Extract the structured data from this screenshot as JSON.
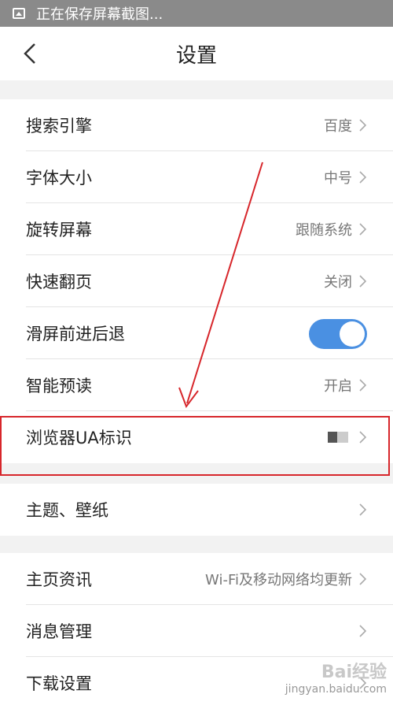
{
  "status_bar": {
    "message": "正在保存屏幕截图..."
  },
  "header": {
    "title": "设置"
  },
  "groups": [
    {
      "rows": [
        {
          "label": "搜索引擎",
          "value": "百度"
        },
        {
          "label": "字体大小",
          "value": "中号"
        },
        {
          "label": "旋转屏幕",
          "value": "跟随系统"
        },
        {
          "label": "快速翻页",
          "value": "关闭"
        },
        {
          "label": "滑屏前进后退",
          "toggle": true,
          "toggle_on": true
        },
        {
          "label": "智能预读",
          "value": "开启"
        },
        {
          "label": "浏览器UA标识",
          "value": ""
        }
      ]
    },
    {
      "rows": [
        {
          "label": "主题、壁纸",
          "value": ""
        }
      ]
    },
    {
      "rows": [
        {
          "label": "主页资讯",
          "value": "Wi-Fi及移动网络均更新"
        },
        {
          "label": "消息管理",
          "value": ""
        },
        {
          "label": "下载设置",
          "value": ""
        }
      ]
    }
  ],
  "watermark": {
    "brand": "Bai经验",
    "url": "jingyan.baidu.com"
  },
  "colors": {
    "toggle_on": "#4a90e2",
    "annotation": "#d7262b"
  }
}
